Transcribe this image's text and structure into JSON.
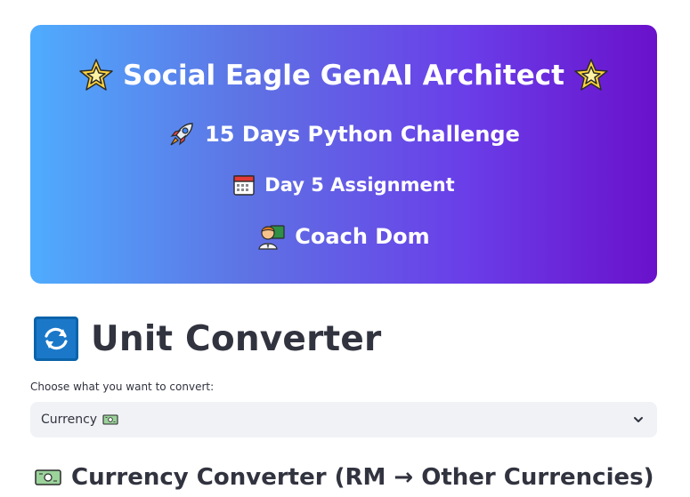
{
  "banner": {
    "title": "Social Eagle GenAI Architect",
    "challenge": "15 Days Python Challenge",
    "assignment": "Day 5 Assignment",
    "coach": "Coach Dom",
    "gradient_start": "#4facfe",
    "gradient_end": "#6a11cb"
  },
  "main": {
    "title": "Unit Converter",
    "select_label": "Choose what you want to convert:",
    "selected_option": "Currency",
    "section_title": "Currency Converter (RM → Other Currencies)"
  },
  "icons": {
    "title_left": "glowing-star-icon",
    "title_right": "glowing-star-icon",
    "challenge": "rocket-icon",
    "assignment": "calendar-icon",
    "coach": "teacher-icon",
    "converter": "refresh-icon",
    "currency": "banknote-icon",
    "dropdown": "chevron-down-icon"
  },
  "colors": {
    "text": "#31333f",
    "select_bg": "#f0f2f6",
    "refresh_bg": "#1b78c9"
  }
}
